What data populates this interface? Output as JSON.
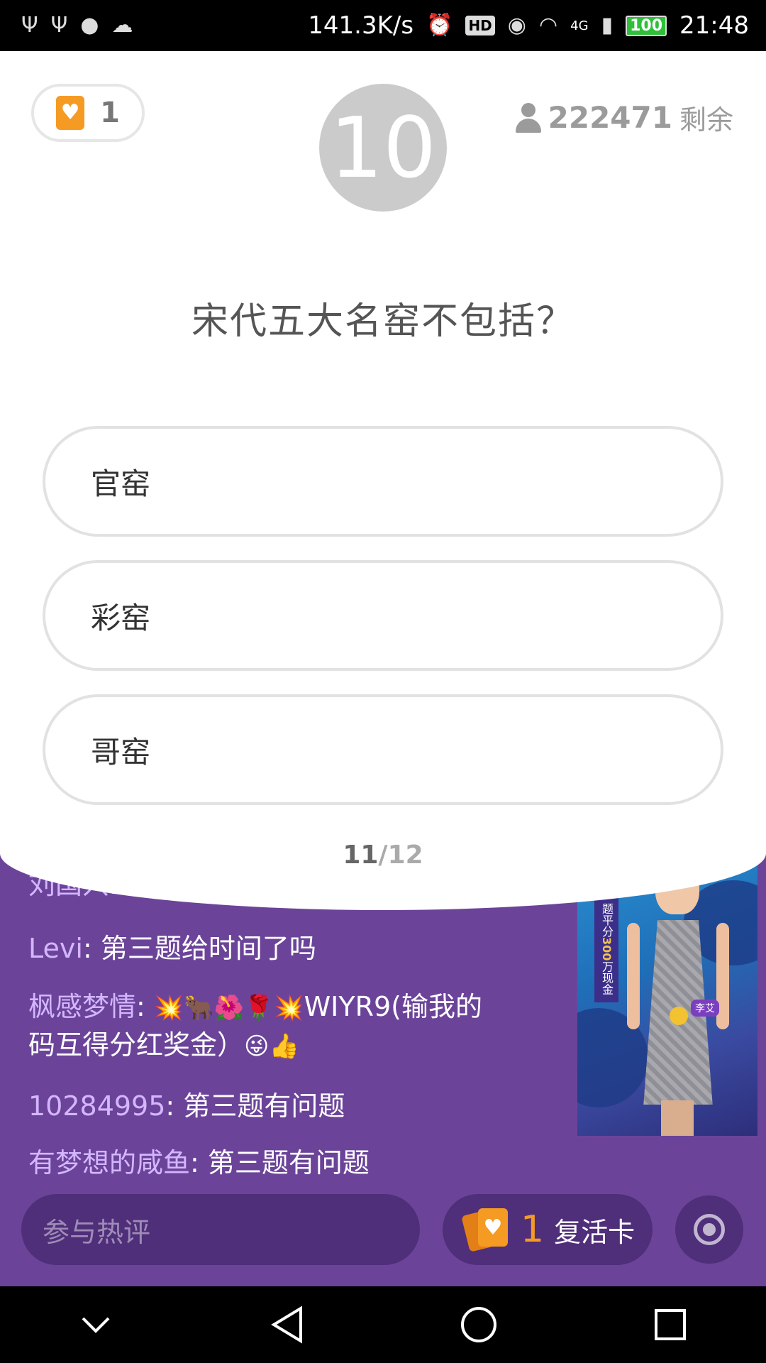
{
  "status_bar": {
    "net_speed": "141.3K/s",
    "hd": "HD",
    "network": "4G",
    "battery": "100",
    "time": "21:48"
  },
  "header": {
    "lives_count": "1",
    "timer": "10",
    "remaining_count": "222471",
    "remaining_label": "剩余"
  },
  "question": {
    "text": "宋代五大名窑不包括？",
    "options": [
      "官窑",
      "彩窑",
      "哥窑"
    ],
    "progress_current": "11",
    "progress_total": "/12"
  },
  "chat": [
    {
      "name": "刘国兴",
      "sep": ": ",
      "text": "...",
      "emoji": ""
    },
    {
      "name": "Levi",
      "sep": ": ",
      "text": "第三题给时间了吗",
      "emoji": ""
    },
    {
      "name": "枫感梦情",
      "sep": ": ",
      "text": "WIYR9(输我的码互得分红奖金）",
      "emoji_pre": "💥🐂🌺🌹💥",
      "emoji": "😜👍"
    },
    {
      "name": "10284995",
      "sep": ": ",
      "text": "第三题有问题",
      "emoji": ""
    },
    {
      "name": "有梦想的咸鱼",
      "sep": ": ",
      "text": "第三题有问题",
      "emoji": ""
    }
  ],
  "host_video": {
    "banner_text": "题平分",
    "banner_amount": "300",
    "banner_suffix": "万现金",
    "host_name": "李艾"
  },
  "bottom_bar": {
    "comment_placeholder": "参与热评",
    "revive_count": "1",
    "revive_label": "复活卡"
  },
  "colors": {
    "background_purple": "#6b4499",
    "accent_orange": "#f59a23",
    "timer_gray": "#cbcbcb"
  }
}
